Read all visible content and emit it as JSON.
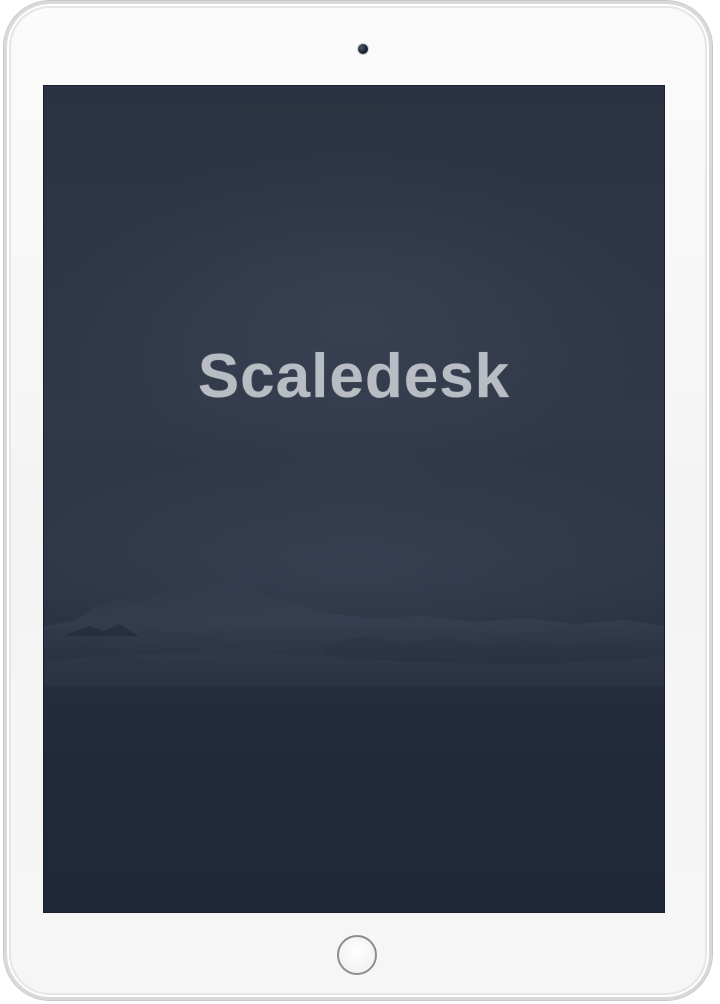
{
  "splash": {
    "logo_text": "Scaledesk"
  },
  "device": {
    "frame_color": "#f7f7f7",
    "screen_color": "#2b3342",
    "camera_icon": "camera-icon",
    "home_button_icon": "home-button-icon"
  }
}
